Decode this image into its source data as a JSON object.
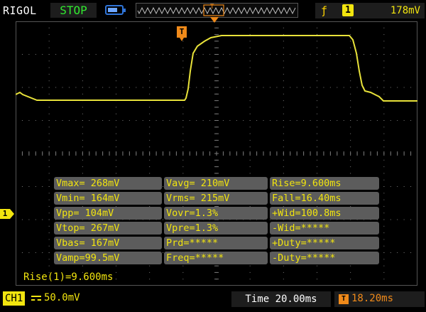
{
  "header": {
    "brand": "RIGOL",
    "run_state": "STOP",
    "battery_level": 0.7,
    "trigger": {
      "edge_icon": "rising-edge-icon",
      "source": "1",
      "level": "178mV"
    },
    "memory_icon": "T"
  },
  "markers": {
    "trigger_position": "T",
    "channel_ground": "1"
  },
  "waveform": {
    "color": "#e8e23a",
    "description_points_us": "trace levels"
  },
  "measurements": [
    [
      "Vmax= 268mV",
      "Vavg= 210mV",
      "Rise=9.600ms"
    ],
    [
      "Vmin= 164mV",
      "Vrms= 215mV",
      "Fall=16.40ms"
    ],
    [
      "Vpp= 104mV",
      "Vovr=1.3%",
      "+Wid=100.8ms"
    ],
    [
      "Vtop= 267mV",
      "Vpre=1.3%",
      "-Wid=*****"
    ],
    [
      "Vbas= 167mV",
      "Prd=*****",
      "+Duty=*****"
    ],
    [
      "Vamp=99.5mV",
      "Freq=*****",
      "-Duty=*****"
    ]
  ],
  "readout": "Rise(1)=9.600ms",
  "footer": {
    "channel_label": "CH1",
    "channel_scale": "50.0mV",
    "timebase": "Time 20.00ms",
    "trigger_offset_icon": "T",
    "trigger_offset": "18.20ms"
  },
  "colors": {
    "trace": "#e8e23a",
    "trigger": "#f08a1a",
    "run_state": "#31e82f",
    "grid": "#7a7a7a"
  }
}
